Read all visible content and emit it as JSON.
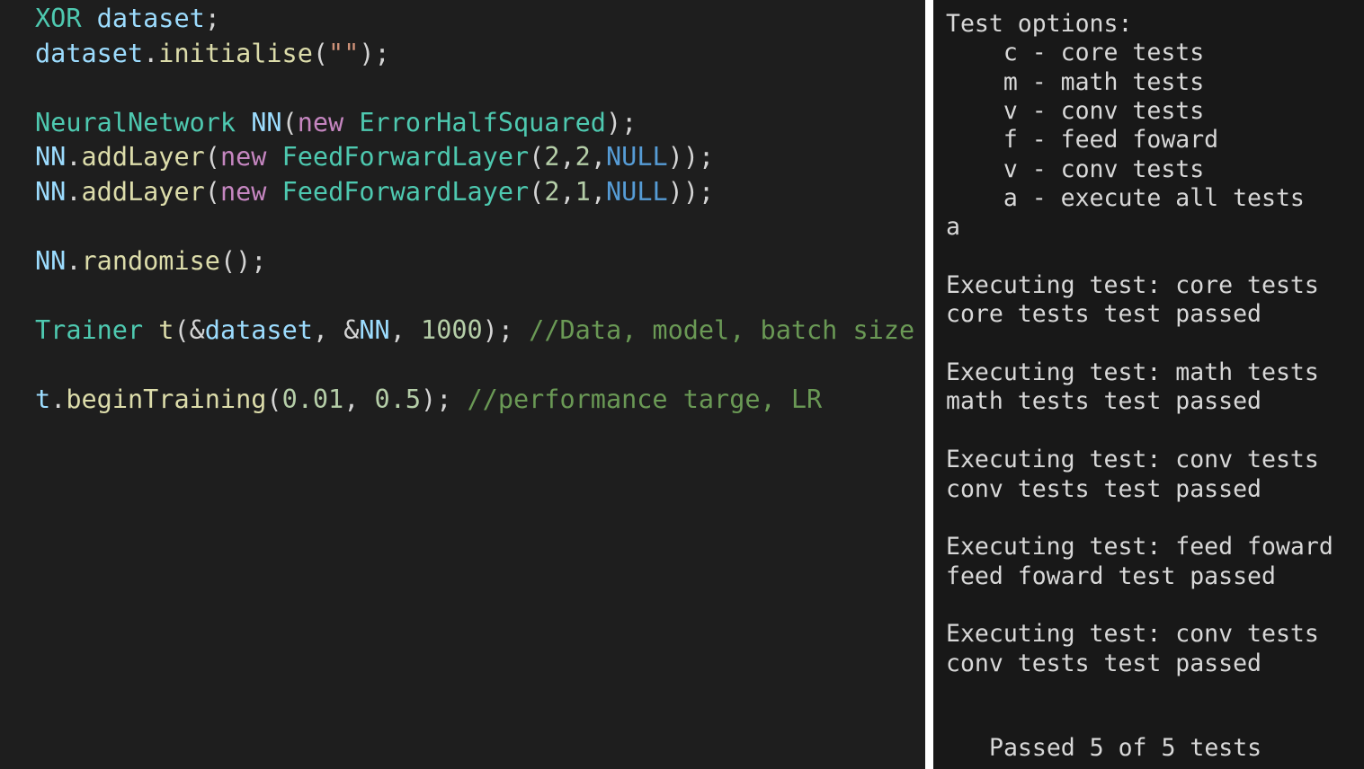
{
  "editor": {
    "lines": [
      [
        {
          "t": "XOR",
          "k": "type"
        },
        {
          "t": " ",
          "k": "punct"
        },
        {
          "t": "dataset",
          "k": "var"
        },
        {
          "t": ";",
          "k": "punct"
        }
      ],
      [
        {
          "t": "dataset",
          "k": "var"
        },
        {
          "t": ".",
          "k": "punct"
        },
        {
          "t": "initialise",
          "k": "fn"
        },
        {
          "t": "(",
          "k": "punct"
        },
        {
          "t": "\"\"",
          "k": "str"
        },
        {
          "t": ");",
          "k": "punct"
        }
      ],
      [],
      [
        {
          "t": "NeuralNetwork",
          "k": "type"
        },
        {
          "t": " ",
          "k": "punct"
        },
        {
          "t": "NN",
          "k": "var"
        },
        {
          "t": "(",
          "k": "punct"
        },
        {
          "t": "new",
          "k": "kw"
        },
        {
          "t": " ",
          "k": "punct"
        },
        {
          "t": "ErrorHalfSquared",
          "k": "type"
        },
        {
          "t": ");",
          "k": "punct"
        }
      ],
      [
        {
          "t": "NN",
          "k": "var"
        },
        {
          "t": ".",
          "k": "punct"
        },
        {
          "t": "addLayer",
          "k": "fn"
        },
        {
          "t": "(",
          "k": "punct"
        },
        {
          "t": "new",
          "k": "kw"
        },
        {
          "t": " ",
          "k": "punct"
        },
        {
          "t": "FeedForwardLayer",
          "k": "type"
        },
        {
          "t": "(",
          "k": "punct"
        },
        {
          "t": "2",
          "k": "num"
        },
        {
          "t": ",",
          "k": "punct"
        },
        {
          "t": "2",
          "k": "num"
        },
        {
          "t": ",",
          "k": "punct"
        },
        {
          "t": "NULL",
          "k": "const"
        },
        {
          "t": "));",
          "k": "punct"
        }
      ],
      [
        {
          "t": "NN",
          "k": "var"
        },
        {
          "t": ".",
          "k": "punct"
        },
        {
          "t": "addLayer",
          "k": "fn"
        },
        {
          "t": "(",
          "k": "punct"
        },
        {
          "t": "new",
          "k": "kw"
        },
        {
          "t": " ",
          "k": "punct"
        },
        {
          "t": "FeedForwardLayer",
          "k": "type"
        },
        {
          "t": "(",
          "k": "punct"
        },
        {
          "t": "2",
          "k": "num"
        },
        {
          "t": ",",
          "k": "punct"
        },
        {
          "t": "1",
          "k": "num"
        },
        {
          "t": ",",
          "k": "punct"
        },
        {
          "t": "NULL",
          "k": "const"
        },
        {
          "t": "));",
          "k": "punct"
        }
      ],
      [],
      [
        {
          "t": "NN",
          "k": "var"
        },
        {
          "t": ".",
          "k": "punct"
        },
        {
          "t": "randomise",
          "k": "fn"
        },
        {
          "t": "();",
          "k": "punct"
        }
      ],
      [],
      [
        {
          "t": "Trainer",
          "k": "type"
        },
        {
          "t": " ",
          "k": "punct"
        },
        {
          "t": "t",
          "k": "fn"
        },
        {
          "t": "(&",
          "k": "punct"
        },
        {
          "t": "dataset",
          "k": "var"
        },
        {
          "t": ", &",
          "k": "punct"
        },
        {
          "t": "NN",
          "k": "var"
        },
        {
          "t": ", ",
          "k": "punct"
        },
        {
          "t": "1000",
          "k": "num"
        },
        {
          "t": "); ",
          "k": "punct"
        },
        {
          "t": "//Data, model, batch size",
          "k": "comment"
        }
      ],
      [],
      [
        {
          "t": "t",
          "k": "var"
        },
        {
          "t": ".",
          "k": "punct"
        },
        {
          "t": "beginTraining",
          "k": "fn"
        },
        {
          "t": "(",
          "k": "punct"
        },
        {
          "t": "0.01",
          "k": "num"
        },
        {
          "t": ", ",
          "k": "punct"
        },
        {
          "t": "0.5",
          "k": "num"
        },
        {
          "t": "); ",
          "k": "punct"
        },
        {
          "t": "//performance targe, LR",
          "k": "comment"
        }
      ]
    ]
  },
  "terminal": {
    "lines": [
      "Test options:",
      "    c - core tests",
      "    m - math tests",
      "    v - conv tests",
      "    f - feed foward",
      "    v - conv tests",
      "    a - execute all tests",
      "a",
      "",
      "Executing test: core tests",
      "core tests test passed",
      "",
      "Executing test: math tests",
      "math tests test passed",
      "",
      "Executing test: conv tests",
      "conv tests test passed",
      "",
      "Executing test: feed foward",
      "feed foward test passed",
      "",
      "Executing test: conv tests",
      "conv tests test passed"
    ],
    "summary": "Passed 5 of 5 tests"
  },
  "colors": {
    "editor_background": "#1e1e1e",
    "terminal_background": "#181818",
    "type": "#4ec9b0",
    "variable": "#9cdcfe",
    "function": "#dcdcaa",
    "keyword": "#c586c0",
    "constant": "#569cd6",
    "number": "#b5cea8",
    "string": "#ce9178",
    "comment": "#6a9955"
  }
}
